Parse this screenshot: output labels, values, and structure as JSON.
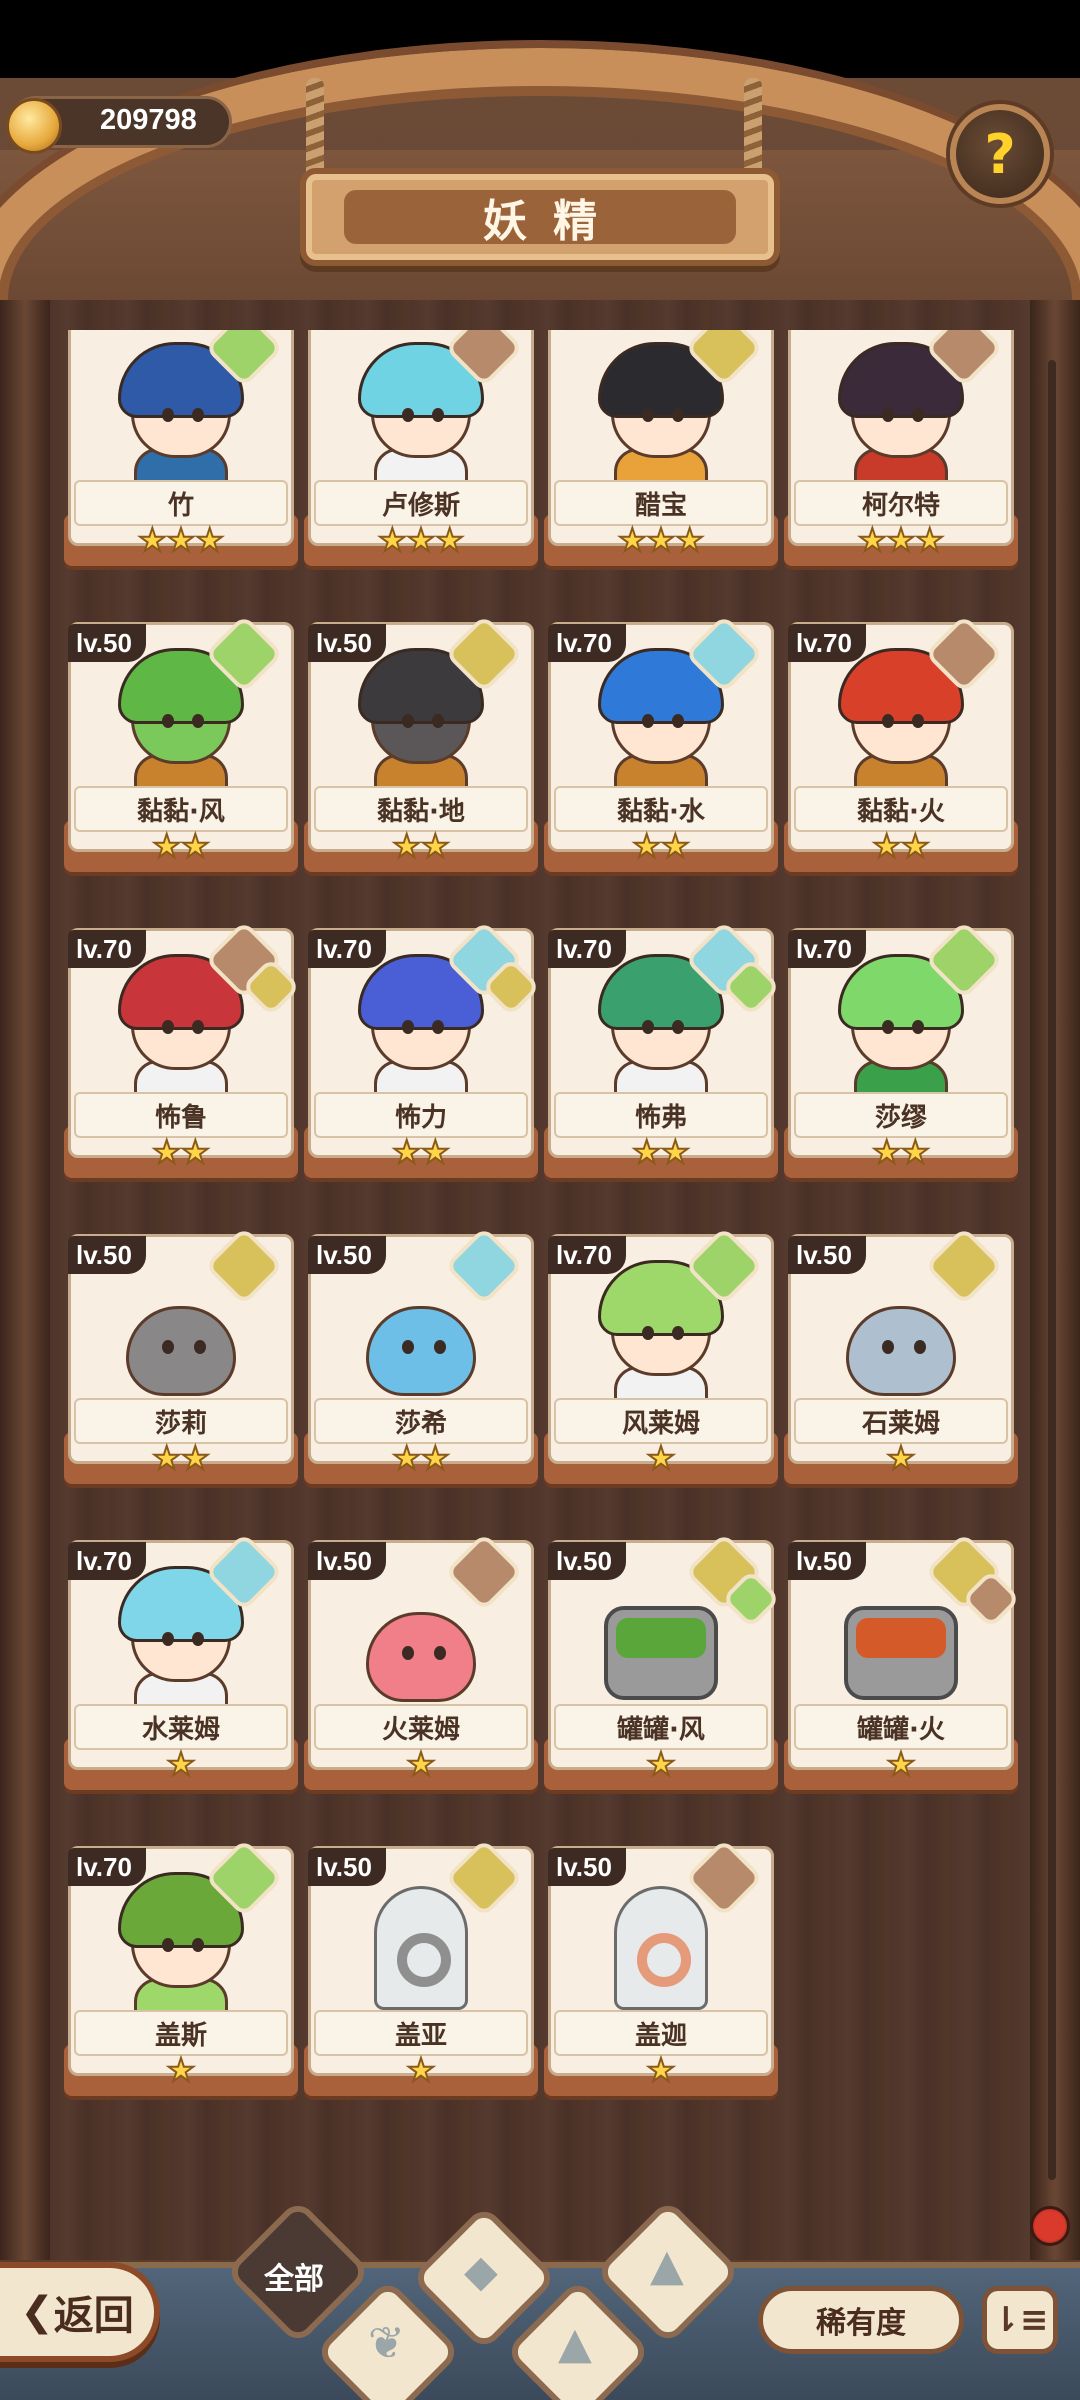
{
  "header": {
    "coin_value": "209798",
    "title": "妖精",
    "help_glyph": "?"
  },
  "cards": [
    {
      "name": "竹",
      "lv": "",
      "stars": "★★★",
      "elements": [
        "wind"
      ],
      "hair": "#2e5aa8",
      "skin": "#ffe6d2",
      "outfit": "#2f6ea8",
      "kind": "person"
    },
    {
      "name": "卢修斯",
      "lv": "",
      "stars": "★★★",
      "elements": [
        "fire"
      ],
      "hair": "#6fd3e3",
      "skin": "#ffe6d2",
      "outfit": "#f2f2f2",
      "kind": "person"
    },
    {
      "name": "醋宝",
      "lv": "",
      "stars": "★★★",
      "elements": [
        "earth"
      ],
      "hair": "#2b2a2e",
      "skin": "#ffe6d2",
      "outfit": "#e9a23a",
      "kind": "person"
    },
    {
      "name": "柯尔特",
      "lv": "",
      "stars": "★★★",
      "elements": [
        "fire"
      ],
      "hair": "#3a2a3a",
      "skin": "#ffe6d2",
      "outfit": "#c83a2a",
      "kind": "person"
    },
    {
      "name": "黏黏·风",
      "lv": "lv.50",
      "stars": "★★",
      "elements": [
        "wind"
      ],
      "hair": "#5fb845",
      "skin": "#7ac95a",
      "outfit": "#c8822e",
      "kind": "person"
    },
    {
      "name": "黏黏·地",
      "lv": "lv.50",
      "stars": "★★",
      "elements": [
        "earth"
      ],
      "hair": "#3c3a3c",
      "skin": "#5b5758",
      "outfit": "#c8822e",
      "kind": "person"
    },
    {
      "name": "黏黏·水",
      "lv": "lv.70",
      "stars": "★★",
      "elements": [
        "water"
      ],
      "hair": "#2f7ad8",
      "skin": "#ffe6d2",
      "outfit": "#c8822e",
      "kind": "person"
    },
    {
      "name": "黏黏·火",
      "lv": "lv.70",
      "stars": "★★",
      "elements": [
        "fire"
      ],
      "hair": "#d8402a",
      "skin": "#ffe6d2",
      "outfit": "#c8822e",
      "kind": "person"
    },
    {
      "name": "怖鲁",
      "lv": "lv.70",
      "stars": "★★",
      "elements": [
        "fire",
        "earth"
      ],
      "hair": "#c8353a",
      "skin": "#ffe6d2",
      "outfit": "#f2f2f2",
      "kind": "person"
    },
    {
      "name": "怖力",
      "lv": "lv.70",
      "stars": "★★",
      "elements": [
        "water",
        "earth"
      ],
      "hair": "#4a5ed6",
      "skin": "#ffe6d2",
      "outfit": "#f2f2f2",
      "kind": "person"
    },
    {
      "name": "怖弗",
      "lv": "lv.70",
      "stars": "★★",
      "elements": [
        "water",
        "wind"
      ],
      "hair": "#3aa16e",
      "skin": "#ffe6d2",
      "outfit": "#f2f2f2",
      "kind": "person"
    },
    {
      "name": "莎缪",
      "lv": "lv.70",
      "stars": "★★",
      "elements": [
        "wind"
      ],
      "hair": "#7fd86a",
      "skin": "#ffe6d2",
      "outfit": "#3aa14a",
      "kind": "person"
    },
    {
      "name": "莎莉",
      "lv": "lv.50",
      "stars": "★★",
      "elements": [
        "earth"
      ],
      "hair": "#5b5758",
      "skin": "#8a8788",
      "outfit": "#c8a77a",
      "kind": "blob"
    },
    {
      "name": "莎希",
      "lv": "lv.50",
      "stars": "★★",
      "elements": [
        "water"
      ],
      "hair": "#4aa6e0",
      "skin": "#6dbfe8",
      "outfit": "#c8a77a",
      "kind": "blob"
    },
    {
      "name": "风莱姆",
      "lv": "lv.70",
      "stars": "★",
      "elements": [
        "wind"
      ],
      "hair": "#9fd86a",
      "skin": "#ffe6d2",
      "outfit": "#f2f2f2",
      "kind": "person"
    },
    {
      "name": "石莱姆",
      "lv": "lv.50",
      "stars": "★",
      "elements": [
        "earth"
      ],
      "hair": "#9fb8cf",
      "skin": "#aebfd0",
      "outfit": "#aebfd0",
      "kind": "blob"
    },
    {
      "name": "水莱姆",
      "lv": "lv.70",
      "stars": "★",
      "elements": [
        "water"
      ],
      "hair": "#7fd6e8",
      "skin": "#ffe6d2",
      "outfit": "#f2f2f2",
      "kind": "person"
    },
    {
      "name": "火莱姆",
      "lv": "lv.50",
      "stars": "★",
      "elements": [
        "fire"
      ],
      "hair": "#ef6b7a",
      "skin": "#f07f8a",
      "outfit": "#f07f8a",
      "kind": "blob"
    },
    {
      "name": "罐罐·风",
      "lv": "lv.50",
      "stars": "★",
      "elements": [
        "earth",
        "wind"
      ],
      "hair": "#5aa63a",
      "skin": "#5aa63a",
      "outfit": "#5aa63a",
      "kind": "can"
    },
    {
      "name": "罐罐·火",
      "lv": "lv.50",
      "stars": "★",
      "elements": [
        "earth",
        "fire"
      ],
      "hair": "#d45a2a",
      "skin": "#d45a2a",
      "outfit": "#d45a2a",
      "kind": "can"
    },
    {
      "name": "盖斯",
      "lv": "lv.70",
      "stars": "★",
      "elements": [
        "wind"
      ],
      "hair": "#6aa83a",
      "skin": "#ffe6d2",
      "outfit": "#9fd86a",
      "kind": "person"
    },
    {
      "name": "盖亚",
      "lv": "lv.50",
      "stars": "★",
      "elements": [
        "earth"
      ],
      "hair": "#8f8f8f",
      "skin": "#8f8f8f",
      "outfit": "#8f8f8f",
      "kind": "jar"
    },
    {
      "name": "盖迦",
      "lv": "lv.50",
      "stars": "★",
      "elements": [
        "fire"
      ],
      "hair": "#e59a7a",
      "skin": "#e59a7a",
      "outfit": "#e59a7a",
      "kind": "jar"
    }
  ],
  "footer": {
    "back_label": "返回",
    "back_glyph": "❮",
    "filter_all": "全部",
    "rarity_label": "稀有度",
    "sort_glyph": "⇂≡"
  },
  "colors": {
    "wind": "#9ed36a",
    "earth": "#d8c15b",
    "water": "#8fd6e0",
    "fire": "#b88a6c",
    "wood": "#6b4a36",
    "star": "#ffd54a"
  }
}
